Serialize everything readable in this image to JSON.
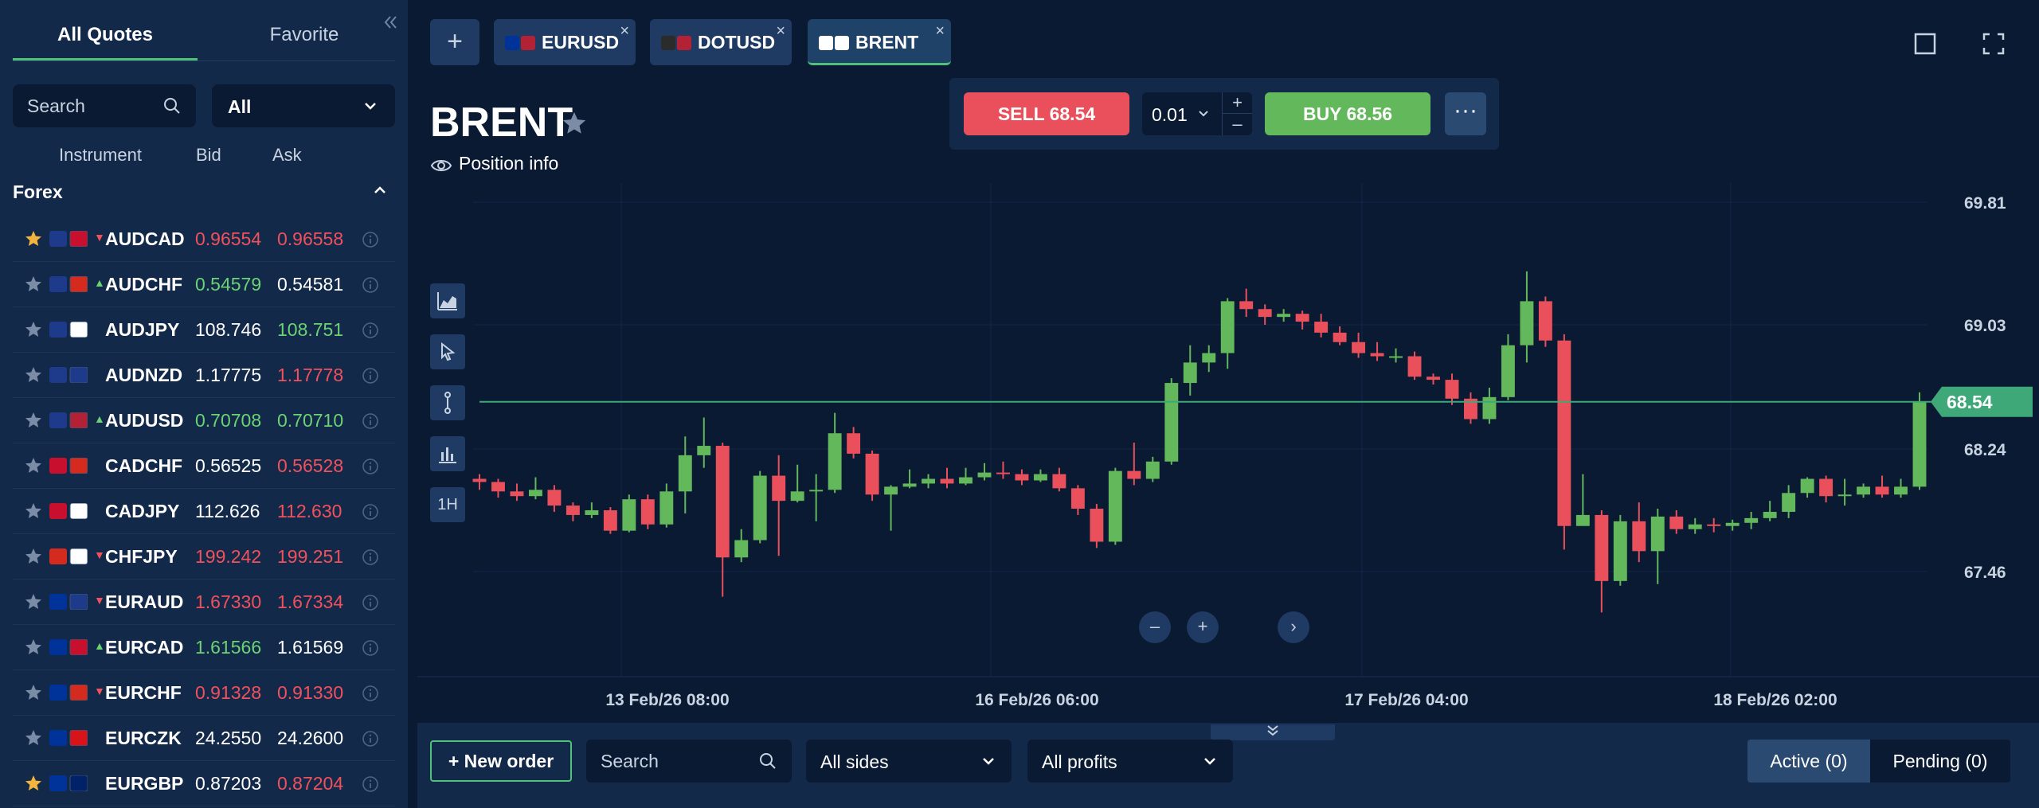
{
  "sidebar": {
    "tabs": {
      "all_quotes": "All Quotes",
      "favorite": "Favorite"
    },
    "search_placeholder": "Search",
    "filter": "All",
    "columns": {
      "instrument": "Instrument",
      "bid": "Bid",
      "ask": "Ask"
    },
    "section": "Forex",
    "quotes": [
      {
        "starred": true,
        "flags": [
          "#1e3a8a",
          "#c8102e"
        ],
        "dir": "down",
        "name": "AUDCAD",
        "bid": "0.96554",
        "ask": "0.96558",
        "bid_color": "down",
        "ask_color": "down"
      },
      {
        "starred": false,
        "flags": [
          "#1e3a8a",
          "#d52b1e"
        ],
        "dir": "up",
        "name": "AUDCHF",
        "bid": "0.54579",
        "ask": "0.54581",
        "bid_color": "up",
        "ask_color": "flat"
      },
      {
        "starred": false,
        "flags": [
          "#1e3a8a",
          "#ffffff"
        ],
        "dir": "none",
        "name": "AUDJPY",
        "bid": "108.746",
        "ask": "108.751",
        "bid_color": "flat",
        "ask_color": "up"
      },
      {
        "starred": false,
        "flags": [
          "#1e3a8a",
          "#1e3a8a"
        ],
        "dir": "none",
        "name": "AUDNZD",
        "bid": "1.17775",
        "ask": "1.17778",
        "bid_color": "flat",
        "ask_color": "down"
      },
      {
        "starred": false,
        "flags": [
          "#1e3a8a",
          "#b22234"
        ],
        "dir": "up",
        "name": "AUDUSD",
        "bid": "0.70708",
        "ask": "0.70710",
        "bid_color": "up",
        "ask_color": "up"
      },
      {
        "starred": false,
        "flags": [
          "#c8102e",
          "#d52b1e"
        ],
        "dir": "none",
        "name": "CADCHF",
        "bid": "0.56525",
        "ask": "0.56528",
        "bid_color": "flat",
        "ask_color": "down"
      },
      {
        "starred": false,
        "flags": [
          "#c8102e",
          "#ffffff"
        ],
        "dir": "none",
        "name": "CADJPY",
        "bid": "112.626",
        "ask": "112.630",
        "bid_color": "flat",
        "ask_color": "down"
      },
      {
        "starred": false,
        "flags": [
          "#d52b1e",
          "#ffffff"
        ],
        "dir": "down",
        "name": "CHFJPY",
        "bid": "199.242",
        "ask": "199.251",
        "bid_color": "down",
        "ask_color": "down"
      },
      {
        "starred": false,
        "flags": [
          "#003399",
          "#1e3a8a"
        ],
        "dir": "down",
        "name": "EURAUD",
        "bid": "1.67330",
        "ask": "1.67334",
        "bid_color": "down",
        "ask_color": "down"
      },
      {
        "starred": false,
        "flags": [
          "#003399",
          "#c8102e"
        ],
        "dir": "up",
        "name": "EURCAD",
        "bid": "1.61566",
        "ask": "1.61569",
        "bid_color": "up",
        "ask_color": "flat"
      },
      {
        "starred": false,
        "flags": [
          "#003399",
          "#d52b1e"
        ],
        "dir": "down",
        "name": "EURCHF",
        "bid": "0.91328",
        "ask": "0.91330",
        "bid_color": "down",
        "ask_color": "down"
      },
      {
        "starred": false,
        "flags": [
          "#003399",
          "#d7141a"
        ],
        "dir": "none",
        "name": "EURCZK",
        "bid": "24.2550",
        "ask": "24.2600",
        "bid_color": "flat",
        "ask_color": "flat"
      },
      {
        "starred": true,
        "flags": [
          "#003399",
          "#012169"
        ],
        "dir": "none",
        "name": "EURGBP",
        "bid": "0.87203",
        "ask": "0.87204",
        "bid_color": "flat",
        "ask_color": "down"
      }
    ]
  },
  "tabs": {
    "items": [
      {
        "label": "EURUSD",
        "flags": [
          "#003399",
          "#b22234"
        ],
        "active": false
      },
      {
        "label": "DOTUSD",
        "flags": [
          "#2b2b2b",
          "#b22234"
        ],
        "active": false
      },
      {
        "label": "BRENT",
        "flags": [
          "#ffffff",
          "#ffffff"
        ],
        "active": true
      }
    ],
    "close_glyph": "×",
    "add_glyph": "+"
  },
  "instrument": {
    "title": "BRENT",
    "position_info": "Position info"
  },
  "trade": {
    "sell_label": "SELL 68.54",
    "lot": "0.01",
    "buy_label": "BUY 68.56",
    "plus": "+",
    "minus": "–",
    "more": "···"
  },
  "chart_tools": {
    "timeframe": "1H"
  },
  "zoom": {
    "out": "–",
    "in": "+",
    "next": "›"
  },
  "chart_data": {
    "type": "candlestick",
    "y_ticks": [
      "69.81",
      "69.03",
      "68.24",
      "67.46"
    ],
    "y_tick_values": [
      69.81,
      69.03,
      68.24,
      67.46
    ],
    "x_ticks": [
      "13 Feb/26 08:00",
      "16 Feb/26 06:00",
      "17 Feb/26 04:00",
      "18 Feb/26 02:00"
    ],
    "current_price": "68.54",
    "current_price_value": 68.54,
    "colors": {
      "up": "#62b85a",
      "down": "#e9505c",
      "price_line": "#3fa878",
      "price_tag": "#3fa878"
    },
    "candles": [
      [
        68.05,
        68.03,
        68.08,
        67.98
      ],
      [
        68.03,
        67.97,
        68.05,
        67.93
      ],
      [
        67.97,
        67.94,
        68.02,
        67.91
      ],
      [
        67.94,
        67.98,
        68.06,
        67.92
      ],
      [
        67.98,
        67.88,
        68.01,
        67.84
      ],
      [
        67.88,
        67.82,
        67.9,
        67.78
      ],
      [
        67.82,
        67.85,
        67.9,
        67.8
      ],
      [
        67.85,
        67.72,
        67.87,
        67.7
      ],
      [
        67.72,
        67.92,
        67.95,
        67.71
      ],
      [
        67.92,
        67.76,
        67.95,
        67.73
      ],
      [
        67.76,
        67.97,
        68.02,
        67.74
      ],
      [
        67.97,
        68.2,
        68.32,
        67.83
      ],
      [
        68.2,
        68.26,
        68.44,
        68.12
      ],
      [
        68.26,
        67.55,
        68.28,
        67.3
      ],
      [
        67.55,
        67.66,
        67.73,
        67.52
      ],
      [
        67.66,
        68.07,
        68.1,
        67.64
      ],
      [
        68.07,
        67.91,
        68.2,
        67.56
      ],
      [
        67.91,
        67.97,
        68.14,
        67.9
      ],
      [
        67.97,
        67.98,
        68.08,
        67.78
      ],
      [
        67.98,
        68.34,
        68.47,
        67.96
      ],
      [
        68.34,
        68.21,
        68.38,
        68.18
      ],
      [
        68.21,
        67.95,
        68.23,
        67.91
      ],
      [
        67.95,
        68.0,
        68.01,
        67.72
      ],
      [
        68.0,
        68.02,
        68.11,
        67.99
      ],
      [
        68.02,
        68.05,
        68.08,
        67.99
      ],
      [
        68.05,
        68.02,
        68.12,
        67.99
      ],
      [
        68.02,
        68.06,
        68.12,
        68.01
      ],
      [
        68.06,
        68.09,
        68.15,
        68.04
      ],
      [
        68.09,
        68.08,
        68.16,
        68.05
      ],
      [
        68.08,
        68.04,
        68.11,
        68.01
      ],
      [
        68.04,
        68.08,
        68.11,
        68.03
      ],
      [
        68.08,
        67.99,
        68.12,
        67.97
      ],
      [
        67.99,
        67.86,
        68.01,
        67.82
      ],
      [
        67.86,
        67.65,
        67.89,
        67.61
      ],
      [
        67.65,
        68.1,
        68.12,
        67.63
      ],
      [
        68.1,
        68.05,
        68.28,
        68.01
      ],
      [
        68.05,
        68.16,
        68.19,
        68.03
      ],
      [
        68.16,
        68.66,
        68.69,
        68.14
      ],
      [
        68.66,
        68.79,
        68.9,
        68.58
      ],
      [
        68.79,
        68.85,
        68.9,
        68.73
      ],
      [
        68.85,
        69.18,
        69.2,
        68.75
      ],
      [
        69.18,
        69.13,
        69.26,
        69.08
      ],
      [
        69.13,
        69.08,
        69.16,
        69.03
      ],
      [
        69.08,
        69.1,
        69.13,
        69.05
      ],
      [
        69.1,
        69.05,
        69.12,
        69.0
      ],
      [
        69.05,
        68.98,
        69.1,
        68.95
      ],
      [
        68.98,
        68.92,
        69.02,
        68.9
      ],
      [
        68.92,
        68.85,
        68.98,
        68.82
      ],
      [
        68.85,
        68.83,
        68.92,
        68.8
      ],
      [
        68.83,
        68.83,
        68.88,
        68.79
      ],
      [
        68.83,
        68.7,
        68.86,
        68.68
      ],
      [
        68.7,
        68.68,
        68.72,
        68.65
      ],
      [
        68.68,
        68.56,
        68.72,
        68.52
      ],
      [
        68.56,
        68.43,
        68.6,
        68.4
      ],
      [
        68.43,
        68.57,
        68.63,
        68.4
      ],
      [
        68.57,
        68.9,
        68.97,
        68.55
      ],
      [
        68.9,
        69.18,
        69.37,
        68.79
      ],
      [
        69.18,
        68.93,
        69.21,
        68.89
      ],
      [
        68.93,
        67.75,
        68.97,
        67.6
      ],
      [
        67.75,
        67.82,
        68.08,
        67.78
      ],
      [
        67.82,
        67.4,
        67.85,
        67.2
      ],
      [
        67.4,
        67.78,
        67.82,
        67.37
      ],
      [
        67.78,
        67.59,
        67.9,
        67.52
      ],
      [
        67.59,
        67.81,
        67.86,
        67.38
      ],
      [
        67.81,
        67.73,
        67.85,
        67.7
      ],
      [
        67.73,
        67.76,
        67.8,
        67.7
      ],
      [
        67.76,
        67.75,
        67.8,
        67.71
      ],
      [
        67.75,
        67.77,
        67.79,
        67.72
      ],
      [
        67.77,
        67.8,
        67.84,
        67.73
      ],
      [
        67.8,
        67.84,
        67.91,
        67.78
      ],
      [
        67.84,
        67.96,
        68.01,
        67.8
      ],
      [
        67.96,
        68.05,
        68.06,
        67.93
      ],
      [
        68.05,
        67.94,
        68.07,
        67.9
      ],
      [
        67.94,
        67.95,
        68.05,
        67.88
      ],
      [
        67.95,
        68.0,
        68.02,
        67.93
      ],
      [
        68.0,
        67.95,
        68.07,
        67.93
      ],
      [
        67.95,
        68.0,
        68.05,
        67.93
      ],
      [
        68.0,
        68.54,
        68.6,
        67.98
      ]
    ]
  },
  "bottom": {
    "new_order": "+ New order",
    "search_placeholder": "Search",
    "sides": "All sides",
    "profits": "All profits",
    "active": "Active (0)",
    "pending": "Pending (0)"
  }
}
